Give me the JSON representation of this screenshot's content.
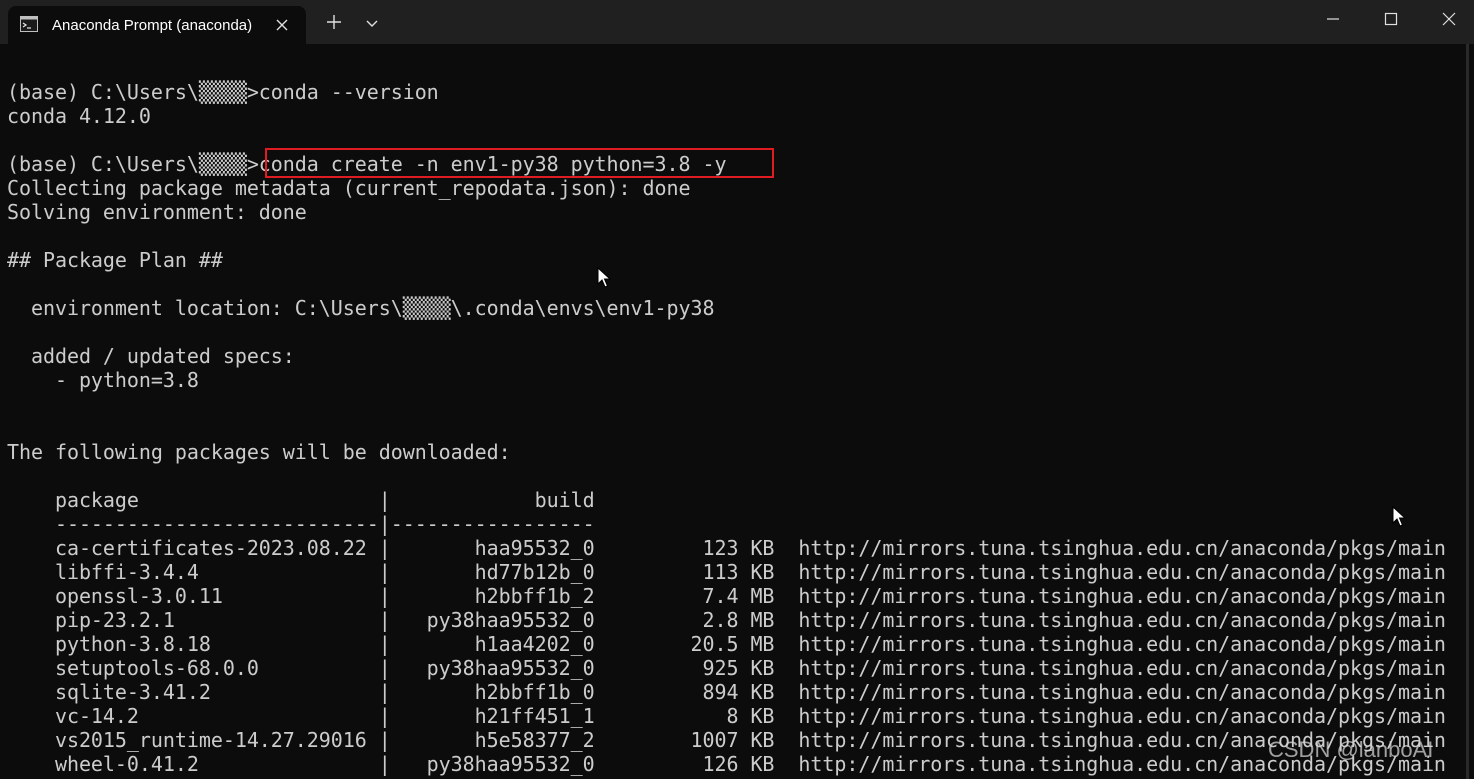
{
  "window": {
    "tab_title": "Anaconda Prompt (anaconda)",
    "icons": {
      "tab": "terminal-icon",
      "tab_close": "close-icon",
      "new_tab": "plus-icon",
      "dropdown": "chevron-down-icon",
      "minimize": "minimize-icon",
      "maximize": "maximize-icon",
      "close": "close-icon"
    }
  },
  "terminal": {
    "lines": [
      "(base) C:\\Users\\▒▒▒▒>conda --version",
      "conda 4.12.0",
      "",
      "(base) C:\\Users\\▒▒▒▒>conda create -n env1-py38 python=3.8 -y",
      "Collecting package metadata (current_repodata.json): done",
      "Solving environment: done",
      "",
      "## Package Plan ##",
      "",
      "  environment location: C:\\Users\\▒▒▒▒\\.conda\\envs\\env1-py38",
      "",
      "  added / updated specs:",
      "    - python=3.8",
      "",
      "",
      "The following packages will be downloaded:",
      "",
      "    package                    |            build",
      "    ---------------------------|-----------------",
      "    ca-certificates-2023.08.22 |       haa95532_0         123 KB  http://mirrors.tuna.tsinghua.edu.cn/anaconda/pkgs/main",
      "    libffi-3.4.4               |       hd77b12b_0         113 KB  http://mirrors.tuna.tsinghua.edu.cn/anaconda/pkgs/main",
      "    openssl-3.0.11             |       h2bbff1b_2         7.4 MB  http://mirrors.tuna.tsinghua.edu.cn/anaconda/pkgs/main",
      "    pip-23.2.1                 |   py38haa95532_0         2.8 MB  http://mirrors.tuna.tsinghua.edu.cn/anaconda/pkgs/main",
      "    python-3.8.18              |       h1aa4202_0        20.5 MB  http://mirrors.tuna.tsinghua.edu.cn/anaconda/pkgs/main",
      "    setuptools-68.0.0          |   py38haa95532_0         925 KB  http://mirrors.tuna.tsinghua.edu.cn/anaconda/pkgs/main",
      "    sqlite-3.41.2              |       h2bbff1b_0         894 KB  http://mirrors.tuna.tsinghua.edu.cn/anaconda/pkgs/main",
      "    vc-14.2                    |       h21ff451_1           8 KB  http://mirrors.tuna.tsinghua.edu.cn/anaconda/pkgs/main",
      "    vs2015_runtime-14.27.29016 |       h5e58377_2        1007 KB  http://mirrors.tuna.tsinghua.edu.cn/anaconda/pkgs/main",
      "    wheel-0.41.2               |   py38haa95532_0         126 KB  http://mirrors.tuna.tsinghua.edu.cn/anaconda/pkgs/main"
    ]
  },
  "watermark": "CSDN @lanboAI",
  "colors": {
    "titlebar_bg": "#202020",
    "terminal_bg": "#0c0c0c",
    "terminal_text": "#cccccc",
    "highlight_border": "#e11b22"
  }
}
